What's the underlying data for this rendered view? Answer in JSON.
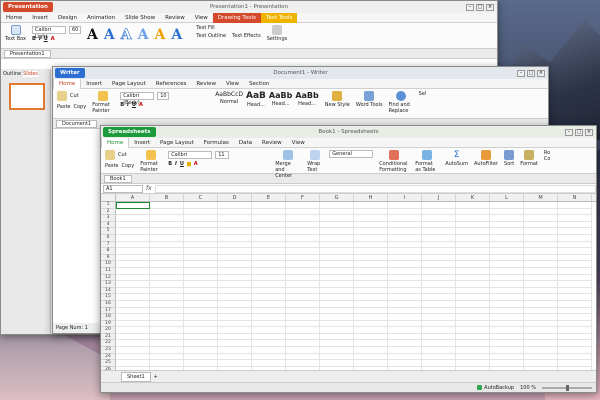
{
  "presentation": {
    "app_badge": "Presentation",
    "title": "Presentation1 - Presentation",
    "menus": [
      "Home",
      "Insert",
      "Design",
      "Animation",
      "Slide Show",
      "Review",
      "View"
    ],
    "context_tabs": {
      "drawing": "Drawing Tools",
      "text": "Text Tools"
    },
    "ribbon": {
      "text_box": "Text Box",
      "font": "Calibri Light",
      "size": "60",
      "text_fill": "Text Fill",
      "text_outline": "Text Outline",
      "text_effects": "Text Effects",
      "settings": "Settings"
    },
    "doc_tab": "Presentation1",
    "side_tabs": [
      "Outline",
      "Slides"
    ],
    "wordart_glyph": "A"
  },
  "writer": {
    "app_badge": "Writer",
    "title": "Document1 - Writer",
    "menus": [
      "Home",
      "Insert",
      "Page Layout",
      "References",
      "Review",
      "View",
      "Section"
    ],
    "ribbon": {
      "paste": "Paste",
      "cut": "Cut",
      "copy": "Copy",
      "format_painter": "Format Painter",
      "font": "Calibri (Body)",
      "size": "10",
      "new_style": "New Style",
      "word_tools": "Word Tools",
      "find_replace": "Find and Replace",
      "select": "Sel"
    },
    "styles": [
      {
        "sample": "AaBbCcD",
        "name": "Normal"
      },
      {
        "sample": "AaB",
        "name": "Head..."
      },
      {
        "sample": "AaBb",
        "name": "Head..."
      },
      {
        "sample": "AaBb",
        "name": "Head..."
      }
    ],
    "doc_tab": "Document1",
    "status": "Page Num: 1"
  },
  "sheet": {
    "app_badge": "Spreadsheets",
    "title": "Book1 - Spreadsheets",
    "menus": [
      "Home",
      "Insert",
      "Page Layout",
      "Formulas",
      "Data",
      "Review",
      "View"
    ],
    "ribbon": {
      "paste": "Paste",
      "cut": "Cut",
      "copy": "Copy",
      "format_painter": "Format Painter",
      "font": "Calibri",
      "size": "11",
      "merge_center": "Merge and Center",
      "wrap_text": "Wrap Text",
      "number_format": "General",
      "cond_format": "Conditional Formatting",
      "format_table": "Format as Table",
      "autosum": "AutoSum",
      "autofilter": "AutoFilter",
      "sort": "Sort",
      "format": "Format",
      "rows_cols": "Ro Co"
    },
    "doc_tab": "Book1",
    "name_box": "A1",
    "fx": "fx",
    "columns": [
      "A",
      "B",
      "C",
      "D",
      "E",
      "F",
      "G",
      "H",
      "I",
      "J",
      "K",
      "L",
      "M",
      "N"
    ],
    "rows": [
      "1",
      "2",
      "3",
      "4",
      "5",
      "6",
      "7",
      "8",
      "9",
      "10",
      "11",
      "12",
      "13",
      "14",
      "15",
      "16",
      "17",
      "18",
      "19",
      "20",
      "21",
      "22",
      "23",
      "24",
      "25",
      "26"
    ],
    "sheet_tab": "Sheet1",
    "autobackup": "AutoBackup",
    "zoom": "100 %"
  }
}
